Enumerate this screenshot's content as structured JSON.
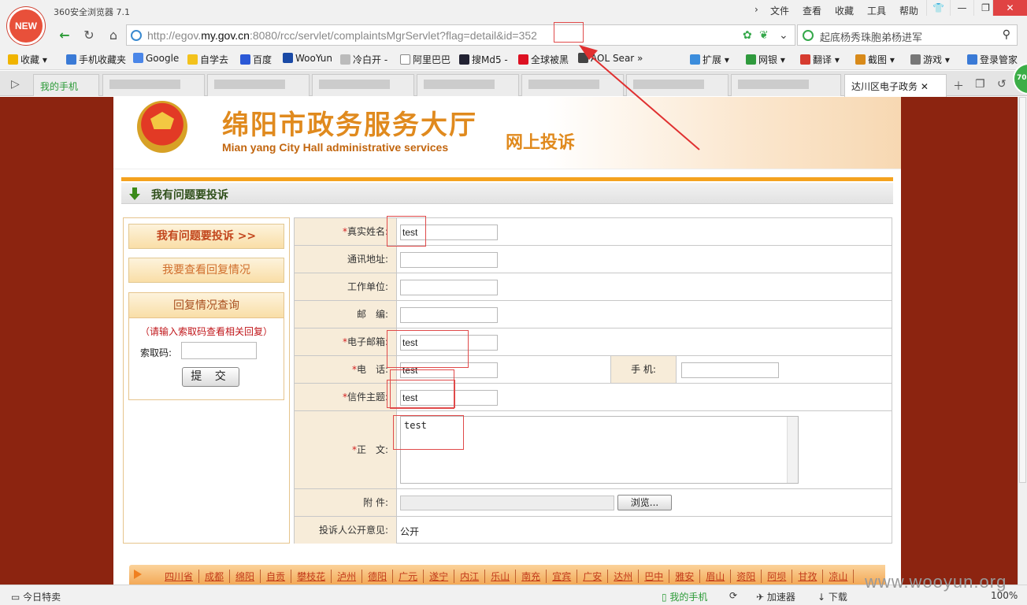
{
  "browser": {
    "logo_text": "NEW",
    "app_title": "360安全浏览器 7.1",
    "menus": [
      "文件",
      "查看",
      "收藏",
      "工具",
      "帮助"
    ],
    "url_prefix": "http://egov.",
    "url_host": "my.gov.cn",
    "url_path": ":8080/rcc/servlet/complaintsMgrServlet?flag=detail&id=",
    "url_id": "352",
    "search_text": "起底杨秀珠胞弟杨进军",
    "bookmarks": [
      "收藏",
      "手机收藏夹",
      "Google",
      "自学去",
      "百度",
      "WooYun",
      "冷白开 -",
      "阿里巴巴",
      "搜Md5 -",
      "全球被黑",
      "AOL Sear",
      "扩展",
      "网银",
      "翻译",
      "截图",
      "游戏",
      "登录管家"
    ],
    "tabs": [
      "我的手机",
      "达川区电子政务"
    ],
    "green_badge": "70"
  },
  "page": {
    "banner_title": "绵阳市政务服务大厅",
    "banner_subtitle": "Mian yang City Hall administrative services",
    "banner_tag": "网上投诉",
    "section_title": "我有问题要投诉",
    "left": {
      "btn_complain": "我有问题要投诉 >>",
      "btn_view_reply": "我要查看回复情况",
      "query_title": "回复情况查询",
      "query_hint": "（请输入索取码查看相关回复）",
      "query_label": "索取码:",
      "query_submit": "提 交"
    },
    "form": {
      "name_label": "真实姓名:",
      "name_value": "test",
      "address_label": "通讯地址:",
      "work_label": "工作单位:",
      "zip_label": "邮　编:",
      "email_label": "电子邮箱:",
      "email_value": "test",
      "phone_label": "电　话:",
      "phone_value": "test",
      "mobile_label": "手 机:",
      "subject_label": "信件主题:",
      "subject_value": "test",
      "body_label": "正　文:",
      "body_value": "test",
      "attach_label": "附 件:",
      "browse_label": "浏览...",
      "public_label": "投诉人公开意见:",
      "public_value": "公开",
      "required_mark": "*"
    },
    "footer_regions": [
      "四川省",
      "成都",
      "绵阳",
      "自贡",
      "攀枝花",
      "泸州",
      "德阳",
      "广元",
      "遂宁",
      "内江",
      "乐山",
      "南充",
      "宜宾",
      "广安",
      "达州",
      "巴中",
      "雅安",
      "眉山",
      "资阳",
      "阿坝",
      "甘孜",
      "凉山"
    ]
  },
  "statusbar": {
    "today": "今日特卖",
    "phone": "我的手机",
    "accelerator": "加速器",
    "download": "下载",
    "zoom": "100%"
  },
  "watermark": "www.wooyun.org"
}
